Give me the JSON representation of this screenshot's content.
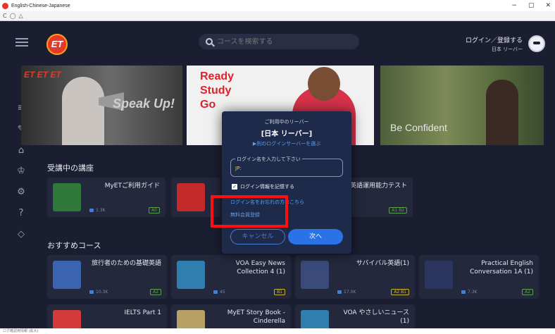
{
  "window": {
    "title": "English-Chinese-Japanese",
    "min": "−",
    "max": "▢",
    "close": "✕"
  },
  "nav": {
    "back": "C",
    "home": "◯",
    "settings": "△"
  },
  "header": {
    "search_placeholder": "コースを検索する",
    "login_label": "ログイン／登録する",
    "server_label": "日本 リーバー"
  },
  "banners": [
    {
      "brand": "ET ET ET",
      "text": "Speak Up!"
    },
    {
      "text": [
        "Ready",
        "Study",
        "Go"
      ]
    },
    {
      "text": "Be Confident"
    }
  ],
  "sections": {
    "enrolled": "受講中の講座",
    "recommended": "おすすめコース"
  },
  "enrolled_cards": [
    {
      "title": "MyETご利用ガイド",
      "count": "1.3K",
      "badge": "A0"
    },
    {
      "title": "英語運用能力テスト",
      "count": "",
      "badge": "A1 B2"
    }
  ],
  "recommended_cards": [
    {
      "title": "旅行者のための基礎英語",
      "count": "10.3K",
      "badge": "A2"
    },
    {
      "title": "VOA Easy News Collection 4 (1)",
      "count": "45",
      "badge": "B1"
    },
    {
      "title": "サバイバル英語(1)",
      "count": "17.0K",
      "badge": "A2 B1"
    },
    {
      "title": "Practical English Conversation 1A (1)",
      "count": "7.3K",
      "badge": "A2"
    },
    {
      "title": "IELTS Part 1",
      "count": "",
      "badge": ""
    },
    {
      "title": "MyET Story Book - Cinderella",
      "count": "",
      "badge": ""
    },
    {
      "title": "VOA やさしいニュース (1)",
      "count": "",
      "badge": ""
    }
  ],
  "modal": {
    "caption": "ご利用中のリーバー",
    "server": "[日本 リーバー]",
    "other_server_link": "▶別のログインサーバーを選ぶ",
    "field_label": "ログイン名を入力して下さい",
    "field_value": "JP:",
    "remember": "ログイン情報を記憶する",
    "forgot": "ログイン名をお忘れの方はこちら",
    "register": "無料会員登録",
    "cancel": "キャンセル",
    "next": "次へ"
  },
  "status": "ログ確認用情報 (拡大)",
  "colors": {
    "accent": "#2a72e6",
    "link": "#5ca0f0",
    "highlight": "#ff1010",
    "background": "#1b1e30"
  }
}
